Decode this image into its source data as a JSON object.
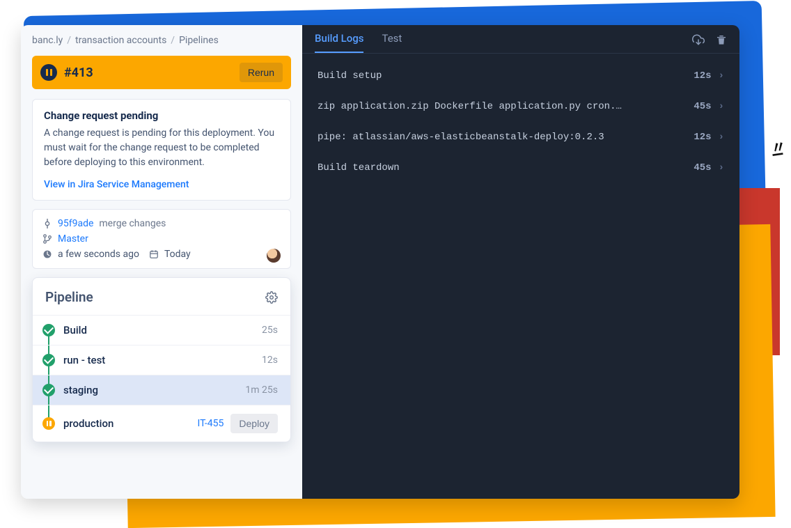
{
  "breadcrumbs": {
    "a": "banc.ly",
    "b": "transaction accounts",
    "c": "Pipelines",
    "sep": "/"
  },
  "run": {
    "number": "#413",
    "rerun": "Rerun"
  },
  "cr": {
    "title": "Change request pending",
    "body": "A change request is pending for this deployment. You must wait for the change request to be completed before deploying to this environment.",
    "link": "View in Jira Service Management"
  },
  "meta": {
    "commit_hash": "95f9ade",
    "commit_msg": "merge changes",
    "branch": "Master",
    "time": "a few seconds ago",
    "date": "Today"
  },
  "pipeline": {
    "title": "Pipeline",
    "steps": [
      {
        "name": "Build",
        "dur": "25s",
        "status": "ok"
      },
      {
        "name": "run - test",
        "dur": "12s",
        "status": "ok"
      },
      {
        "name": "staging",
        "dur": "1m 25s",
        "status": "ok",
        "selected": true
      },
      {
        "name": "production",
        "status": "paused",
        "ticket": "IT-455",
        "deploy": "Deploy"
      }
    ]
  },
  "logs": {
    "tabs": {
      "build": "Build Logs",
      "test": "Test"
    },
    "rows": [
      {
        "text": "Build setup",
        "dur": "12s"
      },
      {
        "text": "zip application.zip Dockerfile application.py cron.y...",
        "dur": "45s"
      },
      {
        "text": "pipe: atlassian/aws-elasticbeanstalk-deploy:0.2.3",
        "dur": "12s"
      },
      {
        "text": "Build teardown",
        "dur": "45s"
      }
    ]
  }
}
